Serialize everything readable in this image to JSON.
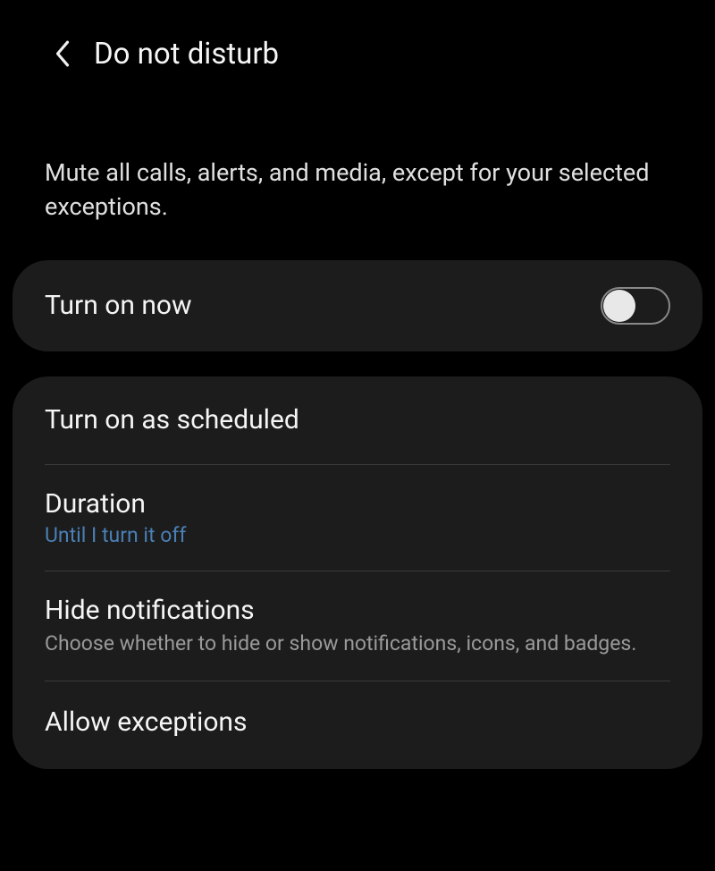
{
  "header": {
    "title": "Do not disturb"
  },
  "description": "Mute all calls, alerts, and media, except for your selected exceptions.",
  "rows": {
    "turnOnNow": {
      "label": "Turn on now"
    },
    "scheduled": {
      "label": "Turn on as scheduled"
    },
    "duration": {
      "label": "Duration",
      "value": "Until I turn it off"
    },
    "hideNotifications": {
      "label": "Hide notifications",
      "description": "Choose whether to hide or show notifications, icons, and badges."
    },
    "allowExceptions": {
      "label": "Allow exceptions"
    }
  }
}
